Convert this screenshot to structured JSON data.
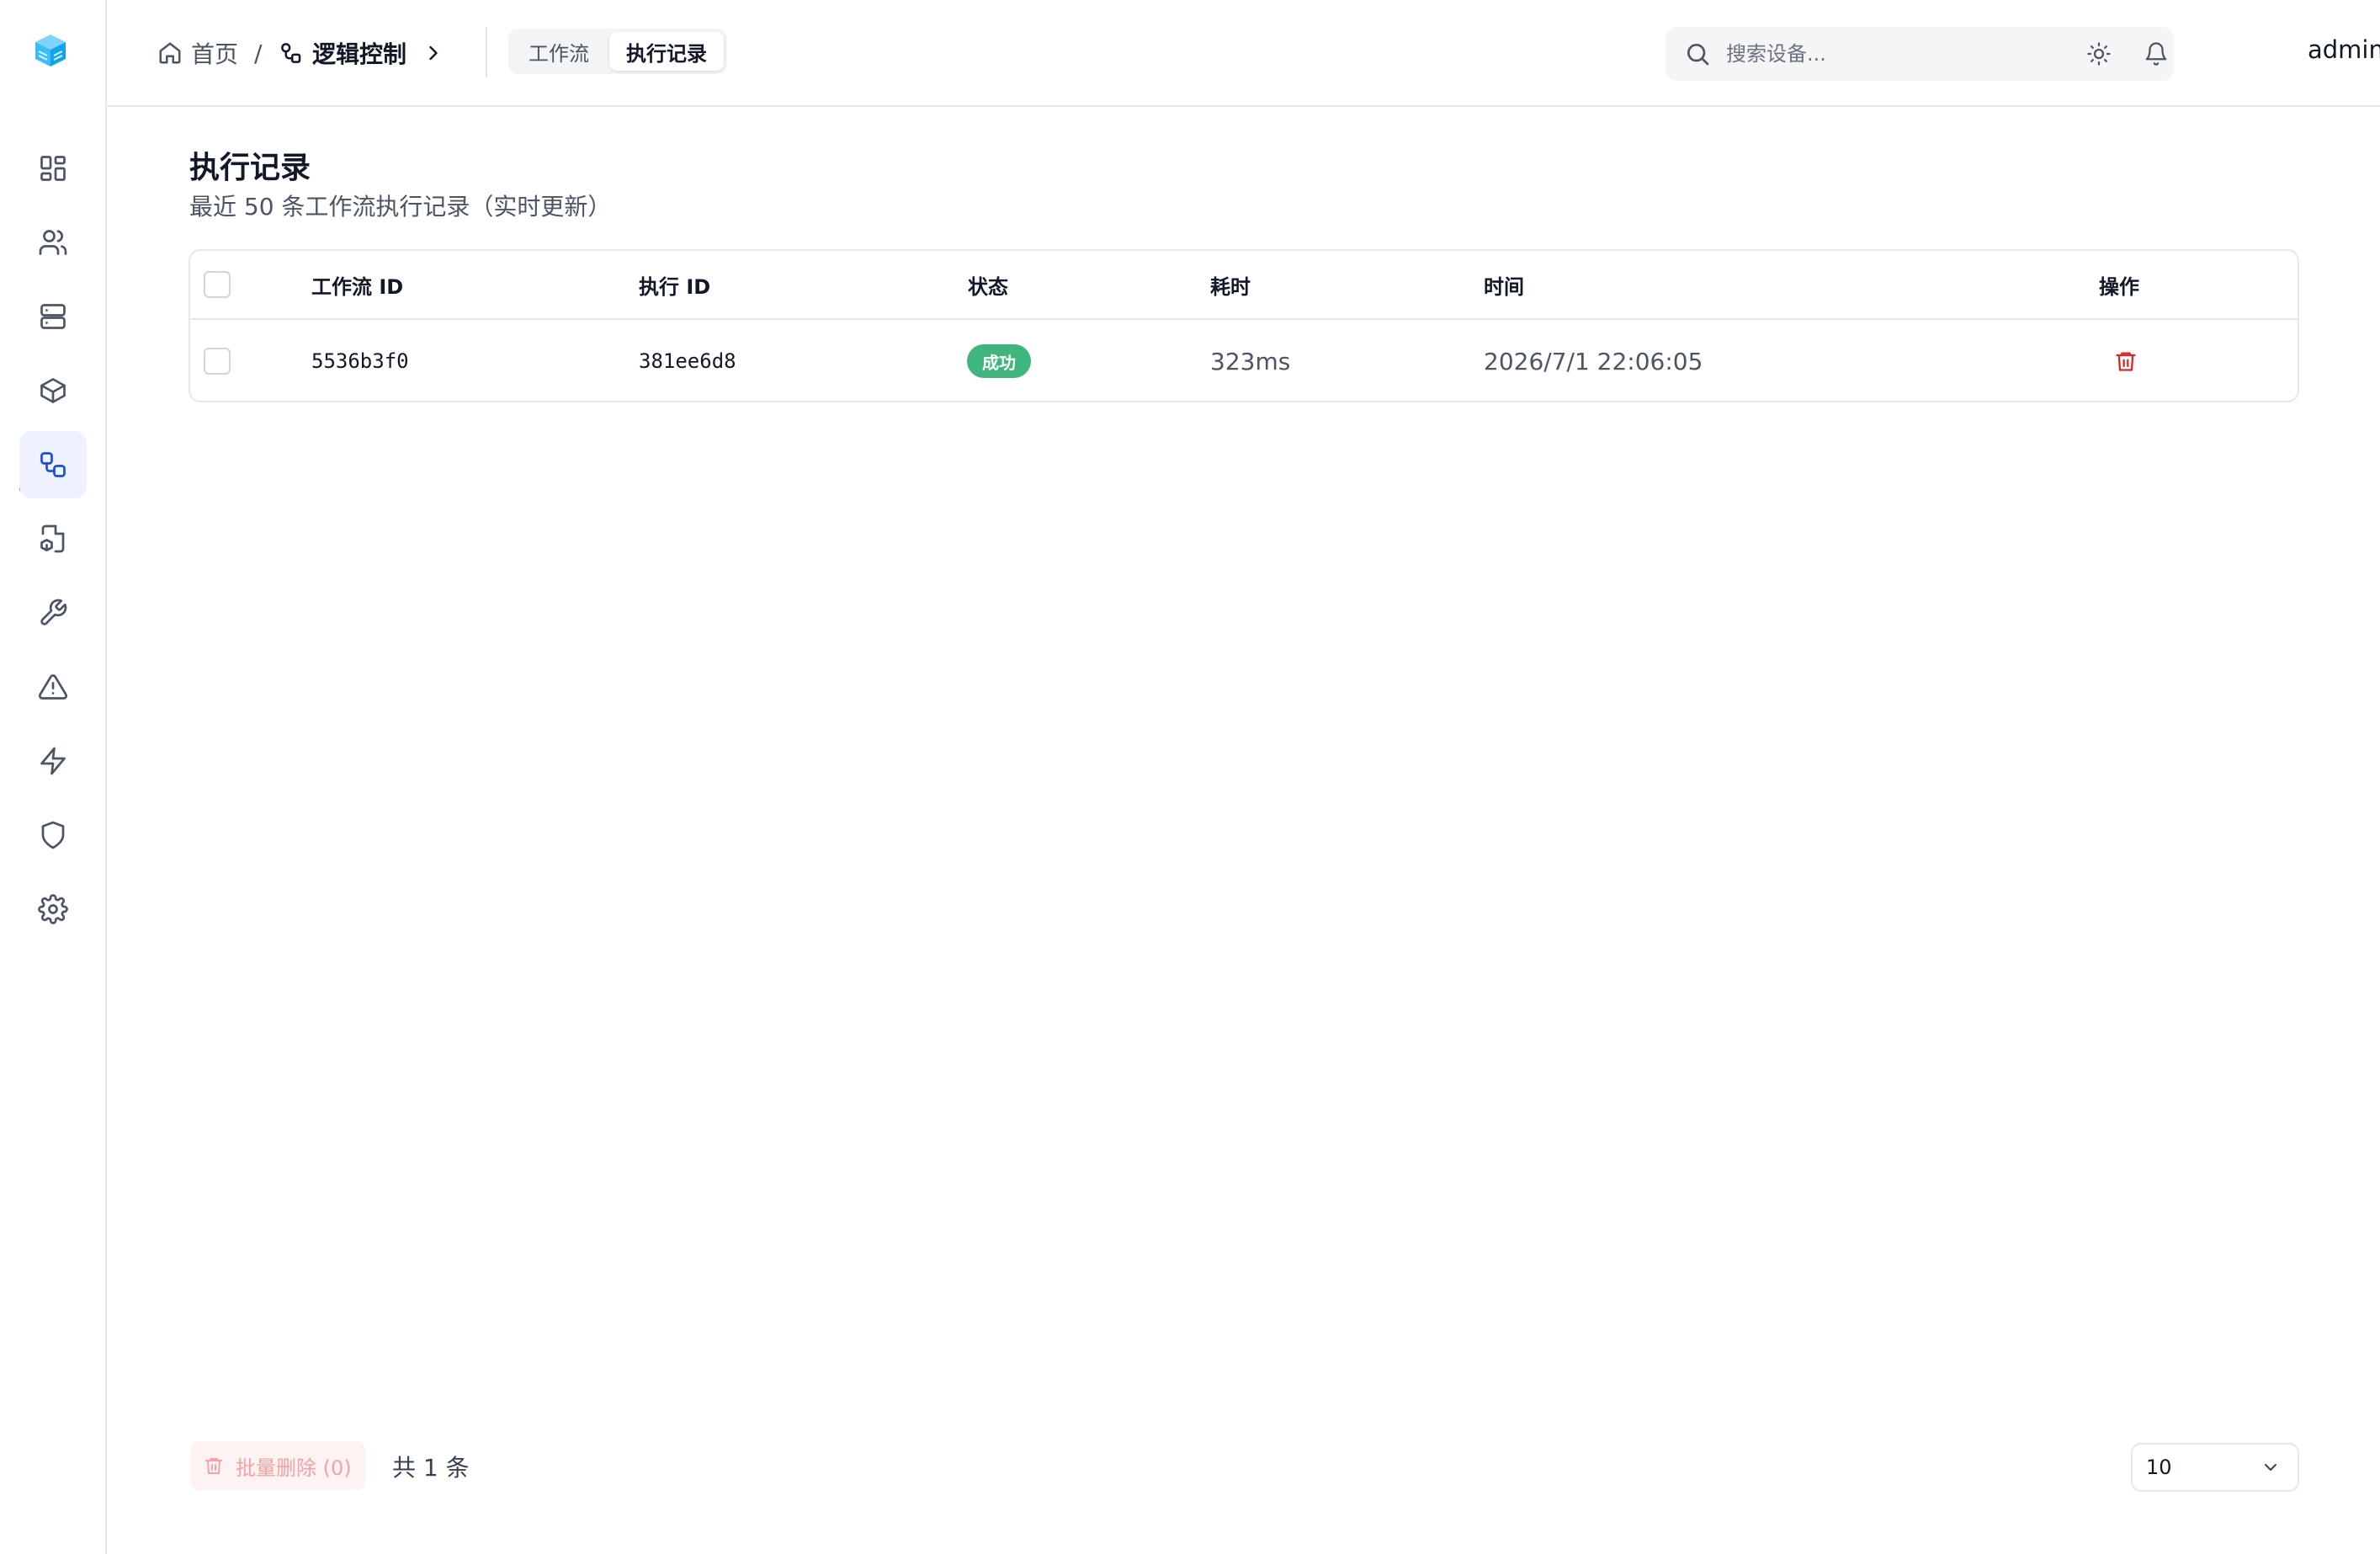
{
  "header": {
    "breadcrumb": {
      "home": "首页",
      "separator": "/",
      "current": "逻辑控制"
    },
    "tabs": [
      {
        "label": "工作流"
      },
      {
        "label": "执行记录"
      }
    ],
    "search": {
      "placeholder": "搜索设备...",
      "value": ""
    },
    "user": {
      "name": "admin"
    }
  },
  "sidebar": {
    "items": [
      {
        "icon": "dashboard-icon"
      },
      {
        "icon": "users-icon"
      },
      {
        "icon": "server-icon"
      },
      {
        "icon": "box-icon"
      },
      {
        "icon": "workflow-icon",
        "active": true
      },
      {
        "icon": "file-box-icon"
      },
      {
        "icon": "wrench-icon"
      },
      {
        "icon": "alert-triangle-icon"
      },
      {
        "icon": "zap-icon"
      },
      {
        "icon": "shield-icon"
      },
      {
        "icon": "settings-icon"
      }
    ]
  },
  "main": {
    "title": "执行记录",
    "subtitle": "最近 50 条工作流执行记录（实时更新）",
    "table": {
      "columns": [
        "工作流 ID",
        "执行 ID",
        "状态",
        "耗时",
        "时间",
        "操作"
      ],
      "rows": [
        {
          "workflow_id": "5536b3f0",
          "execution_id": "381ee6d8",
          "status": "成功",
          "duration": "323ms",
          "time": "2026/7/1 22:06:05"
        }
      ]
    },
    "footer": {
      "bulk_delete": "批量删除 (0)",
      "total": "共 1 条",
      "page_size": "10"
    }
  },
  "colors": {
    "accent": "#1d4ed8",
    "success": "#3fb67d",
    "danger": "#dc2626"
  }
}
